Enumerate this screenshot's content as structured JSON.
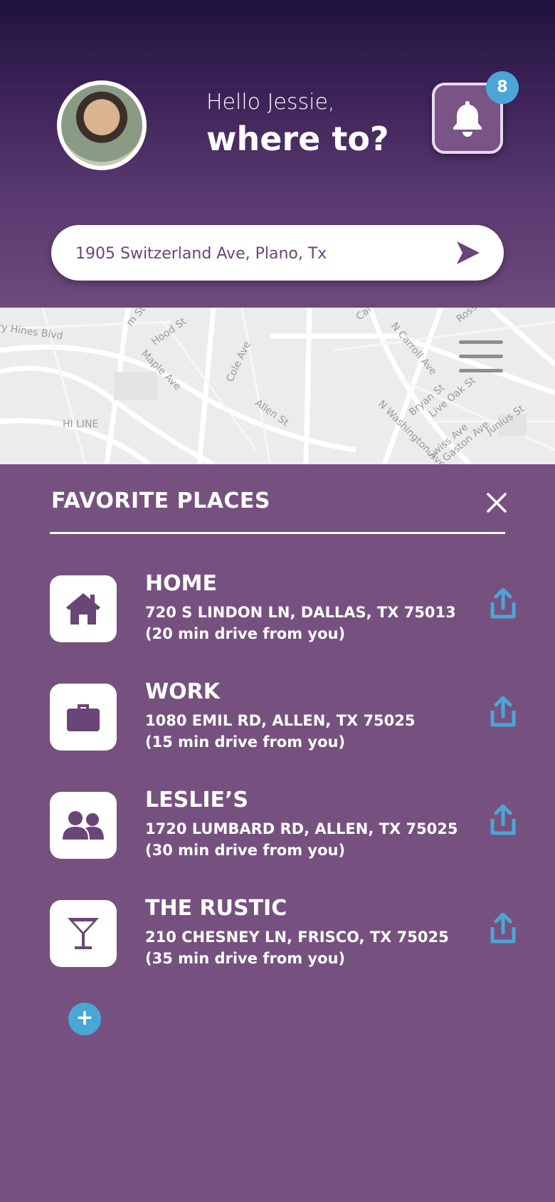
{
  "greeting": {
    "line1": "Hello Jessie,",
    "line2": "where to?"
  },
  "notifications": {
    "count": "8"
  },
  "search": {
    "value": "1905 Switzerland Ave, Plano, Tx"
  },
  "map": {
    "labels": [
      "ry Hines Blvd",
      "Hood St",
      "Maple Ave",
      "Cole Ave",
      "Allen St",
      "HI LINE",
      "N Carroll Ave",
      "Bryan St",
      "Live Oak St",
      "N Washington Ave",
      "Swiss Ave",
      "Gaston Ave",
      "Junius St",
      "Ross",
      "Cal",
      "m St"
    ]
  },
  "favorites": {
    "title": "FAVORITE PLACES",
    "places": [
      {
        "name": "HOME",
        "address": "720 S LINDON LN, DALLAS, TX 75013",
        "drive": "(20 min drive from you)",
        "icon": "house-icon"
      },
      {
        "name": "WORK",
        "address": "1080 EMIL RD, ALLEN, TX 75025",
        "drive": "(15 min drive from you)",
        "icon": "briefcase-icon"
      },
      {
        "name": "LESLIE’S",
        "address": "1720 LUMBARD RD, ALLEN, TX 75025",
        "drive": "(30 min drive from you)",
        "icon": "people-icon"
      },
      {
        "name": "THE RUSTIC",
        "address": "210 CHESNEY LN, FRISCO, TX 75025",
        "drive": "(35 min drive from you)",
        "icon": "cocktail-icon"
      }
    ],
    "add_label": "+"
  },
  "colors": {
    "accent": "#4aa6d6",
    "panel": "#76517f",
    "brand": "#6a4577"
  }
}
